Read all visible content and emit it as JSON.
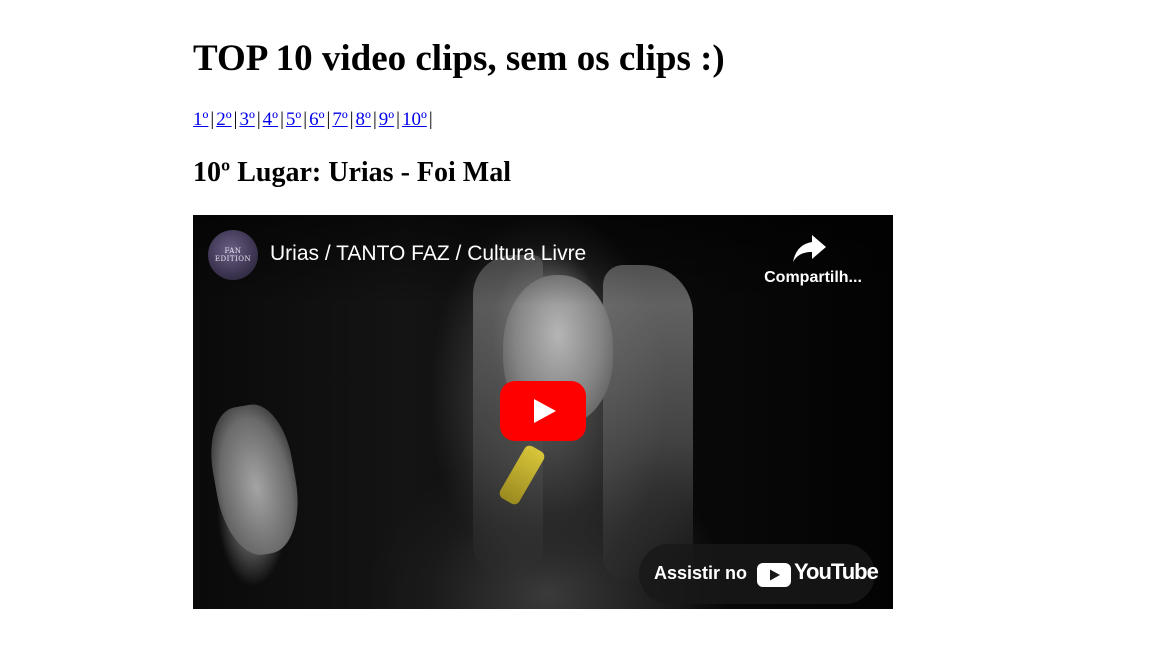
{
  "page": {
    "title": "TOP 10 video clips, sem os clips :)"
  },
  "rank_nav": {
    "items": [
      {
        "label": "1º"
      },
      {
        "label": "2º"
      },
      {
        "label": "3º"
      },
      {
        "label": "4º"
      },
      {
        "label": "5º"
      },
      {
        "label": "6º"
      },
      {
        "label": "7º"
      },
      {
        "label": "8º"
      },
      {
        "label": "9º"
      },
      {
        "label": "10º"
      }
    ],
    "separator": "|"
  },
  "entry": {
    "heading": "10º Lugar: Urias - Foi Mal"
  },
  "video": {
    "channel_avatar_text": "FAN EDITION",
    "title": "Urias / TANTO FAZ / Cultura Livre",
    "share_label": "Compartilh...",
    "watch_label": "Assistir no",
    "youtube_wordmark": "YouTube",
    "play_icon": "play-icon",
    "share_icon": "share-arrow-icon",
    "colors": {
      "play_red": "#ff0000",
      "overlay": "#191919"
    }
  },
  "colors": {
    "link": "#0000ee",
    "text": "#000000",
    "background": "#ffffff"
  }
}
